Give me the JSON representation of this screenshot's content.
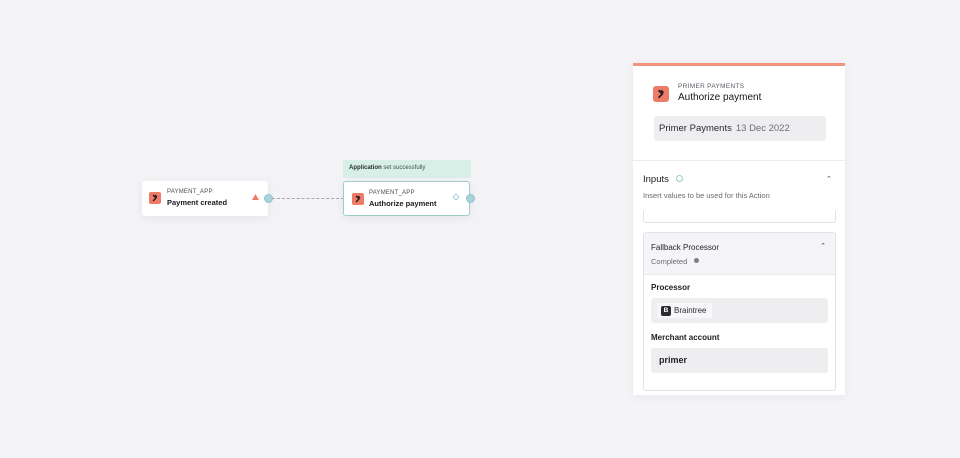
{
  "workflow": {
    "trigger_node": {
      "app": "PAYMENT_APP",
      "title": "Payment created"
    },
    "action_node": {
      "app": "PAYMENT_APP",
      "title": "Authorize payment"
    },
    "toast": {
      "bold": "Application",
      "text": " set successfully"
    }
  },
  "panel": {
    "app": "PRIMER PAYMENTS",
    "title": "Authorize payment",
    "connection": {
      "name": "Primer Payments",
      "date": "13 Dec 2022"
    },
    "inputs": {
      "title": "Inputs",
      "description": "Insert values to be used for this Action"
    },
    "fallback": {
      "title": "Fallback Processor",
      "status": "Completed",
      "processor_label": "Processor",
      "processor_value": "Braintree",
      "processor_logo": "B",
      "merchant_label": "Merchant account",
      "merchant_value": "primer"
    }
  },
  "colors": {
    "accent": "#ee7b66",
    "panel_top": "#f1937f",
    "success_bg": "#d8efe8",
    "port": "#a8d3dc"
  },
  "icons": [
    "app-logo-icon",
    "warning-icon",
    "check-circle-icon",
    "chevron-up-icon",
    "braintree-logo-icon",
    "status-dot-icon"
  ]
}
